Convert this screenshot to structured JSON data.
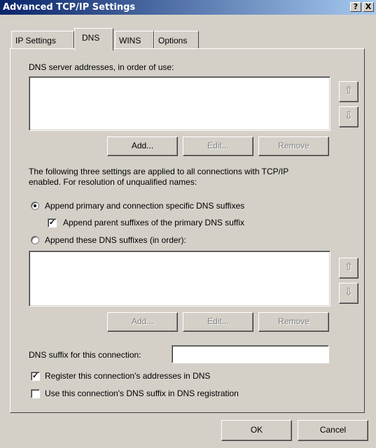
{
  "window": {
    "title": "Advanced TCP/IP Settings",
    "help_label": "?",
    "close_label": "X"
  },
  "tabs": [
    {
      "label": "IP Settings",
      "active": false
    },
    {
      "label": "DNS",
      "active": true
    },
    {
      "label": "WINS",
      "active": false
    },
    {
      "label": "Options",
      "active": false
    }
  ],
  "dns": {
    "servers_label": "DNS server addresses, in order of use:",
    "servers": [],
    "add_label": "Add...",
    "edit_label": "Edit...",
    "remove_label": "Remove",
    "up_icon": "arrow-up-icon",
    "down_icon": "arrow-down-icon",
    "info_text_1": "The following three settings are applied to all connections with TCP/IP",
    "info_text_2": "enabled. For resolution of unqualified names:",
    "radio_primary_label": "Append primary and connection specific DNS suffixes",
    "radio_primary_selected": true,
    "check_parent_label": "Append parent suffixes of the primary DNS suffix",
    "check_parent_checked": true,
    "radio_these_label": "Append these DNS suffixes (in order):",
    "radio_these_selected": false,
    "suffixes": [],
    "suffix_add_label": "Add...",
    "suffix_edit_label": "Edit...",
    "suffix_remove_label": "Remove",
    "conn_suffix_label": "DNS suffix for this connection:",
    "conn_suffix_value": "",
    "register_label": "Register this connection's addresses in DNS",
    "register_checked": true,
    "use_suffix_label": "Use this connection's DNS suffix in DNS registration",
    "use_suffix_checked": false
  },
  "footer": {
    "ok_label": "OK",
    "cancel_label": "Cancel"
  }
}
